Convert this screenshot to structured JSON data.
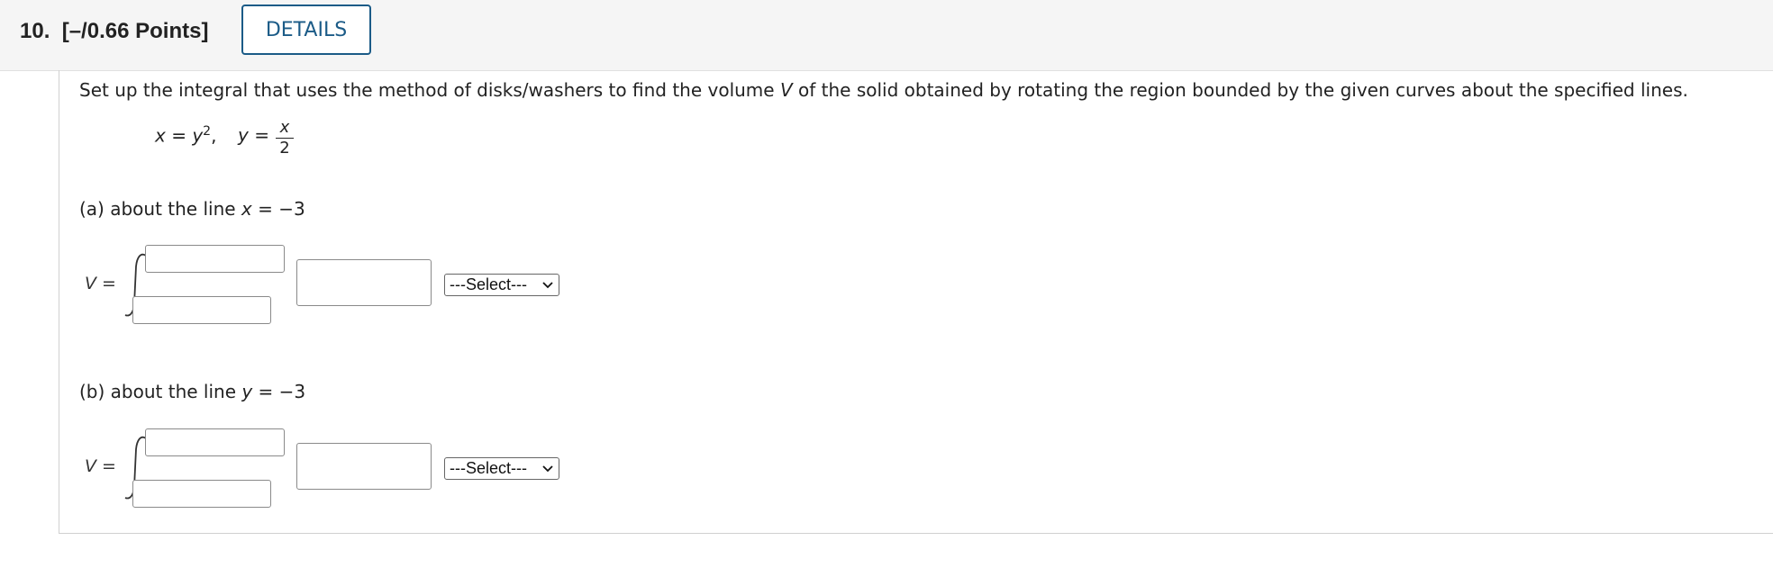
{
  "question": {
    "number": "10.",
    "points": "[–/0.66 Points]",
    "details_label": "DETAILS"
  },
  "prompt": {
    "before_v": "Set up the integral that uses the method of disks/washers to find the volume ",
    "v": "V",
    "after_v": " of the solid obtained by rotating the region bounded by the given curves about the specified lines."
  },
  "curves": {
    "eq1_lhs": "x",
    "eq1_mid": " = ",
    "eq1_rhs": "y",
    "eq1_exp": "2",
    "eq1_sep": ",",
    "eq2_lhs": "y",
    "eq2_mid": " =",
    "frac_num": "x",
    "frac_den": "2"
  },
  "parts": [
    {
      "label_prefix": "(a) about the line ",
      "var": "x",
      "label_suffix": " = −3",
      "v_label": "V =",
      "upper_limit": "",
      "lower_limit": "",
      "integrand": "",
      "select_value": "---Select---"
    },
    {
      "label_prefix": "(b) about the line ",
      "var": "y",
      "label_suffix": " = −3",
      "v_label": "V =",
      "upper_limit": "",
      "lower_limit": "",
      "integrand": "",
      "select_value": "---Select---"
    }
  ]
}
